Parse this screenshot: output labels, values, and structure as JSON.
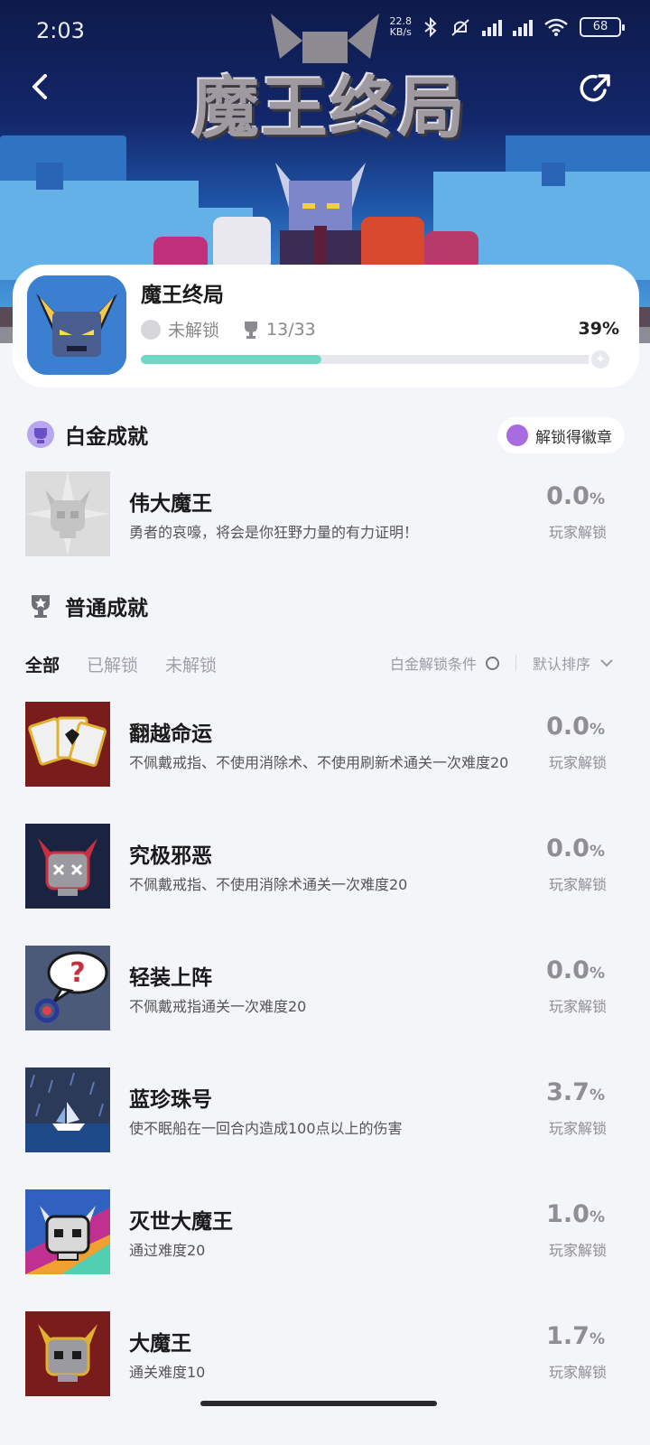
{
  "status_bar": {
    "time": "2:03",
    "net_speed_value": "22.8",
    "net_speed_unit": "KB/s",
    "battery": "68"
  },
  "hero": {
    "logo_text": "魔王终局"
  },
  "game": {
    "title": "魔王终局",
    "platinum_status": "未解锁",
    "trophy_count": "13/33",
    "percent_label": "39%",
    "progress": 0.39
  },
  "platinum_section": {
    "title": "白金成就",
    "badge_button": "解锁得徽章",
    "achievement": {
      "name": "伟大魔王",
      "desc": "勇者的哀嚎，将会是你狂野力量的有力证明！",
      "pct_num": "0.0",
      "pct_unit": "%",
      "unlock_label": "玩家解锁"
    }
  },
  "normal_section": {
    "title": "普通成就",
    "tabs": [
      "全部",
      "已解锁",
      "未解锁"
    ],
    "filter_label": "白金解锁条件",
    "sort_label": "默认排序",
    "achievements": [
      {
        "name": "翻越命运",
        "desc": "不佩戴戒指、不使用消除术、不使用刷新术通关一次难度20",
        "pct_num": "0.0",
        "pct_unit": "%",
        "unlock_label": "玩家解锁"
      },
      {
        "name": "究极邪恶",
        "desc": "不佩戴戒指、不使用消除术通关一次难度20",
        "pct_num": "0.0",
        "pct_unit": "%",
        "unlock_label": "玩家解锁"
      },
      {
        "name": "轻装上阵",
        "desc": "不佩戴戒指通关一次难度20",
        "pct_num": "0.0",
        "pct_unit": "%",
        "unlock_label": "玩家解锁"
      },
      {
        "name": "蓝珍珠号",
        "desc": "使不眠船在一回合内造成100点以上的伤害",
        "pct_num": "3.7",
        "pct_unit": "%",
        "unlock_label": "玩家解锁"
      },
      {
        "name": "灭世大魔王",
        "desc": "通过难度20",
        "pct_num": "1.0",
        "pct_unit": "%",
        "unlock_label": "玩家解锁"
      },
      {
        "name": "大魔王",
        "desc": "通关难度10",
        "pct_num": "1.7",
        "pct_unit": "%",
        "unlock_label": "玩家解锁"
      }
    ]
  },
  "colors": {
    "progress_fill": "#6fd8c4",
    "page_bg": "#f4f5f8",
    "percent_gray": "#8e8e94"
  }
}
